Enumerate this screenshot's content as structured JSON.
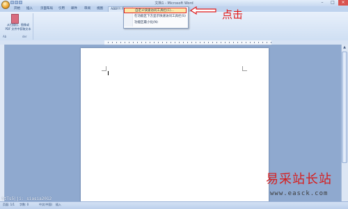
{
  "title_bar": {
    "title": "文档1 - Microsoft Word"
  },
  "tabs": [
    "开始",
    "插入",
    "页面布局",
    "引用",
    "邮件",
    "审阅",
    "视图",
    "ABBYY Fi"
  ],
  "ribbon": {
    "command_line1": "从扫描仪、图像或",
    "command_line2": "PDF 文件中获取文本",
    "group_label": "Ab",
    "group_label_2": "der"
  },
  "menu": {
    "items": [
      "自定义快速访问工具栏(C)...",
      "在功能区下方显示快速访问工具栏(S)",
      "功能区最小化(N)"
    ]
  },
  "annotation": {
    "label": "点击",
    "color": "#e01818"
  },
  "watermark": {
    "name": "易采站长站",
    "url": "www.easck.com",
    "blog": "ttTs5|ji: siasia2012"
  },
  "status_bar": {
    "page": "页面: 1/1",
    "words": "字数: 0",
    "language": "中文(中国)",
    "insert": "插入"
  },
  "colors": {
    "accent": "#1e3f6f",
    "highlight": "#fce9a8",
    "annotation": "#e01818"
  }
}
